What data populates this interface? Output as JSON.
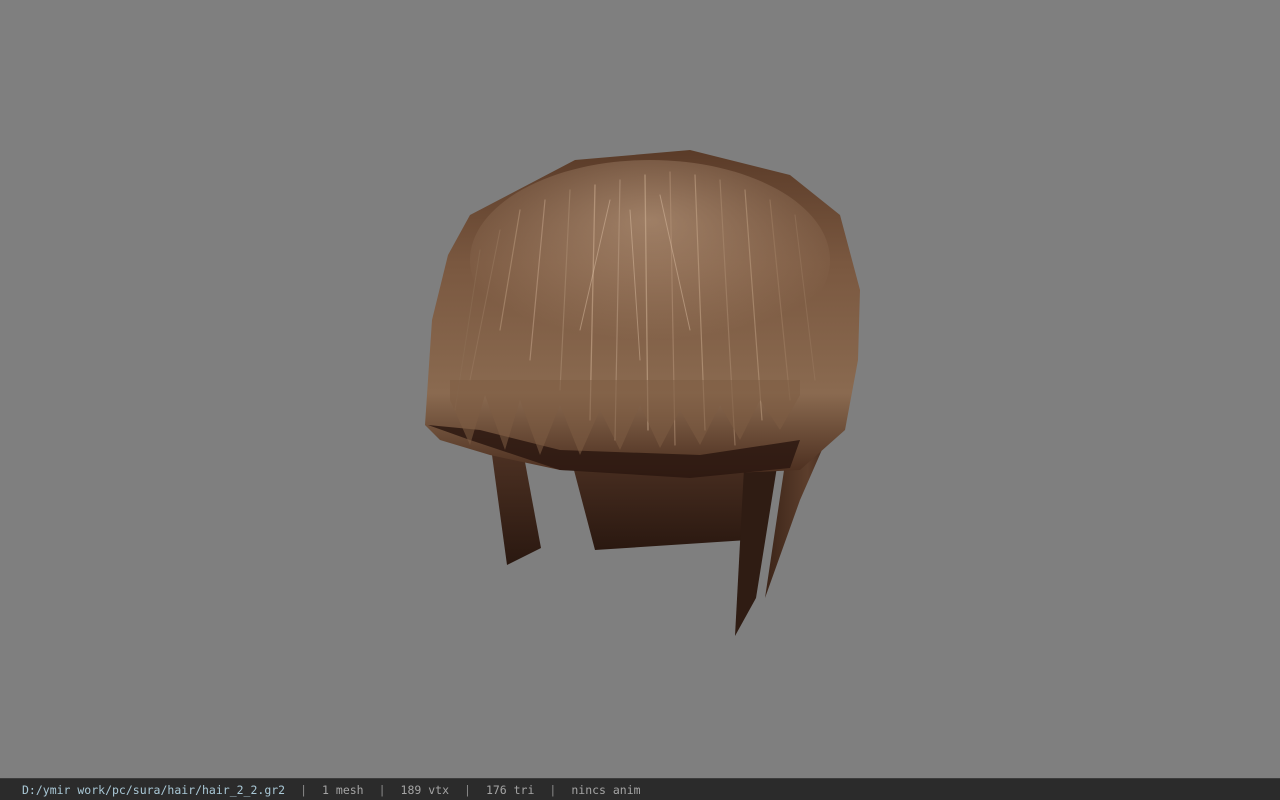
{
  "viewport": {
    "background_color": "#7f7f7f",
    "model": "hair-mesh",
    "hair_colors": {
      "dark": "#3a2317",
      "mid": "#6b4a35",
      "light": "#b8987c",
      "shadow": "#24140f"
    }
  },
  "status_bar": {
    "file_path": "D:/ymir work/pc/sura/hair/hair_2_2.gr2",
    "separator": "|",
    "mesh_count": "1 mesh",
    "vertex_count": "189 vtx",
    "triangle_count": "176 tri",
    "anim": "nincs anim"
  }
}
